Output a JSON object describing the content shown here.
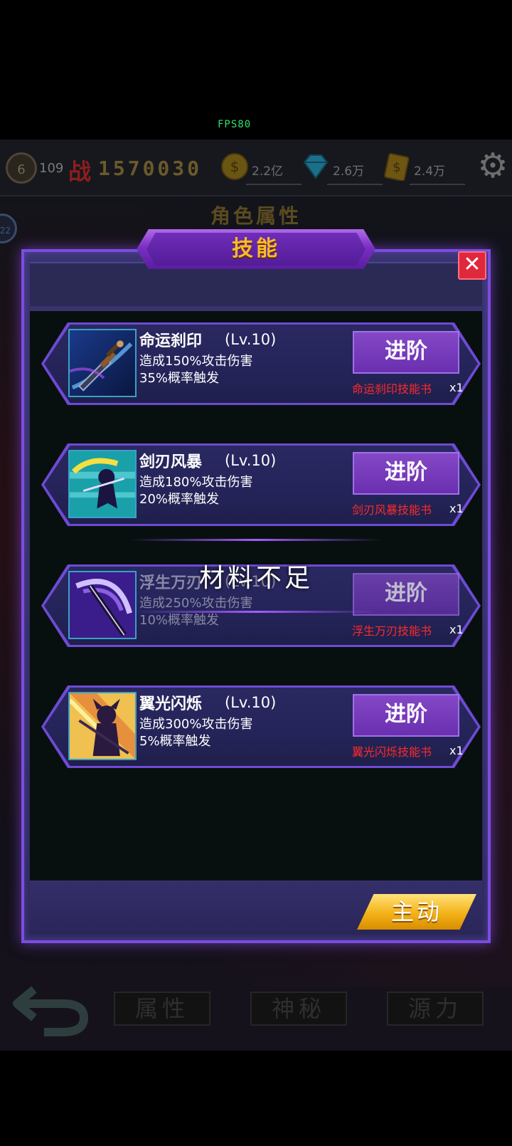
{
  "fps": "FPS80",
  "topbar": {
    "level": "6",
    "level_extra": "109",
    "power_char": "战",
    "power_value": "1570030",
    "gold": "2.2亿",
    "diamond": "2.6万",
    "cash": "2.4万"
  },
  "side_badge": "22",
  "page_heading": "角色属性",
  "modal": {
    "title": "技能",
    "close": "✕",
    "active_tab": "主动"
  },
  "toast": "材料不足",
  "skills": [
    {
      "name": "命运刹印",
      "level": "(Lv.10)",
      "desc1": "造成150%攻击伤害",
      "desc2": "35%概率触发",
      "button": "进阶",
      "book": "命运刹印技能书",
      "count": "x1"
    },
    {
      "name": "剑刃风暴",
      "level": "(Lv.10)",
      "desc1": "造成180%攻击伤害",
      "desc2": "20%概率触发",
      "button": "进阶",
      "book": "剑刃风暴技能书",
      "count": "x1"
    },
    {
      "name": "浮生万刃",
      "level": "(Lv.10)",
      "desc1": "造成250%攻击伤害",
      "desc2": "10%概率触发",
      "button": "进阶",
      "book": "浮生万刃技能书",
      "count": "x1"
    },
    {
      "name": "翼光闪烁",
      "level": "(Lv.10)",
      "desc1": "造成300%攻击伤害",
      "desc2": "5%概率触发",
      "button": "进阶",
      "book": "翼光闪烁技能书",
      "count": "x1"
    }
  ],
  "bottom_nav": {
    "tab1": "属性",
    "tab2": "神秘",
    "tab3": "源力"
  }
}
